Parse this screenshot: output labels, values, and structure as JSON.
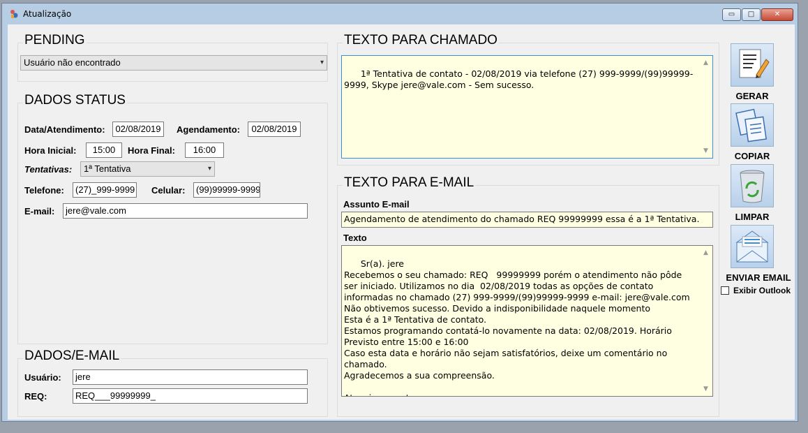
{
  "window": {
    "title": "Atualização",
    "minimize_glyph": "▭",
    "maximize_glyph": "□",
    "close_glyph": "✕"
  },
  "pending": {
    "title": "PENDING",
    "selected": "Usuário não encontrado"
  },
  "dados_status": {
    "title": "DADOS STATUS",
    "data_atendimento_label": "Data/Atendimento:",
    "data_atendimento_value": "02/08/2019",
    "agendamento_label": "Agendamento:",
    "agendamento_value": "02/08/2019",
    "hora_inicial_label": "Hora Inicial:",
    "hora_inicial_value": "15:00",
    "hora_final_label": "Hora Final:",
    "hora_final_value": "16:00",
    "tentativas_label": "Tentativas:",
    "tentativas_value": "1ª Tentativa",
    "telefone_label": "Telefone:",
    "telefone_value": "(27)_999-9999",
    "celular_label": "Celular:",
    "celular_value": "(99)99999-9999",
    "email_label": "E-mail:",
    "email_value": "jere@vale.com"
  },
  "dados_email": {
    "title": "DADOS/E-MAIL",
    "usuario_label": "Usuário:",
    "usuario_value": "jere",
    "req_label": "REQ:",
    "req_value": "REQ___99999999_"
  },
  "texto_chamado": {
    "title": "TEXTO PARA CHAMADO",
    "text": "1ª Tentativa de contato - 02/08/2019 via telefone (27) 999-9999/(99)99999-9999, Skype jere@vale.com - Sem sucesso."
  },
  "texto_email": {
    "title": "TEXTO PARA E-MAIL",
    "assunto_label": "Assunto E-mail",
    "assunto_value": "Agendamento de atendimento do chamado REQ   99999999 essa é a 1ª Tentativa.",
    "texto_label": "Texto",
    "texto_value": "Sr(a). jere\nRecebemos o seu chamado: REQ   99999999 porém o atendimento não pôde ser iniciado. Utilizamos no dia  02/08/2019 todas as opções de contato informadas no chamado (27) 999-9999/(99)99999-9999 e-mail: jere@vale.com Não obtivemos sucesso. Devido a indisponibilidade naquele momento\nEsta é a 1ª Tentativa de contato.\nEstamos programando contatá-lo novamente na data: 02/08/2019. Horário Previsto entre 15:00 e 16:00\nCaso esta data e horário não sejam satisfatórios, deixe um comentário no chamado.\nAgradecemos a sua compreensão.\n\nAtenciosamente\nEquipe DXC.Technology"
  },
  "actions": {
    "gerar_label": "GERAR",
    "copiar_label": "COPIAR",
    "limpar_label": "LIMPAR",
    "enviar_label": "ENVIAR EMAIL",
    "exibir_outlook_label": "Exibir Outlook"
  }
}
